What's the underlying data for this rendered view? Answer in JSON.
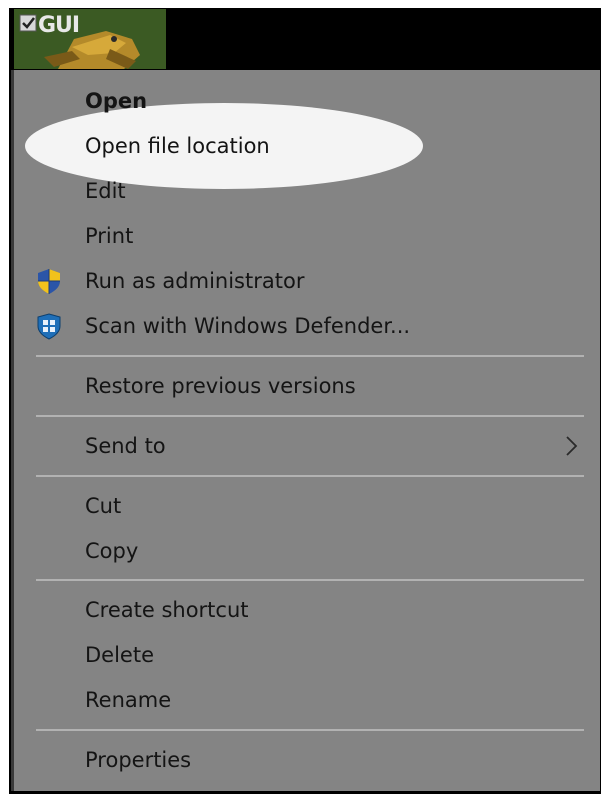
{
  "desktop_icon": {
    "label": "GUI",
    "checkbox_checked": true,
    "icon_name": "frog-app-icon"
  },
  "context_menu": {
    "items": [
      {
        "label": "Open",
        "bold": true
      },
      {
        "label": "Open file location",
        "highlighted": true
      },
      {
        "label": "Edit"
      },
      {
        "label": "Print"
      },
      {
        "label": "Run as administrator",
        "icon": "uac-shield-icon"
      },
      {
        "label": "Scan with Windows Defender...",
        "icon": "windows-defender-icon"
      },
      {
        "label": "Restore previous versions"
      },
      {
        "label": "Send to",
        "submenu": true
      },
      {
        "label": "Cut"
      },
      {
        "label": "Copy"
      },
      {
        "label": "Create shortcut"
      },
      {
        "label": "Delete"
      },
      {
        "label": "Rename"
      },
      {
        "label": "Properties"
      }
    ]
  },
  "colors": {
    "menu_background": "#848484",
    "highlight_ellipse": "#f4f4f4",
    "separator": "#b2b2b2",
    "text": "#141414"
  }
}
